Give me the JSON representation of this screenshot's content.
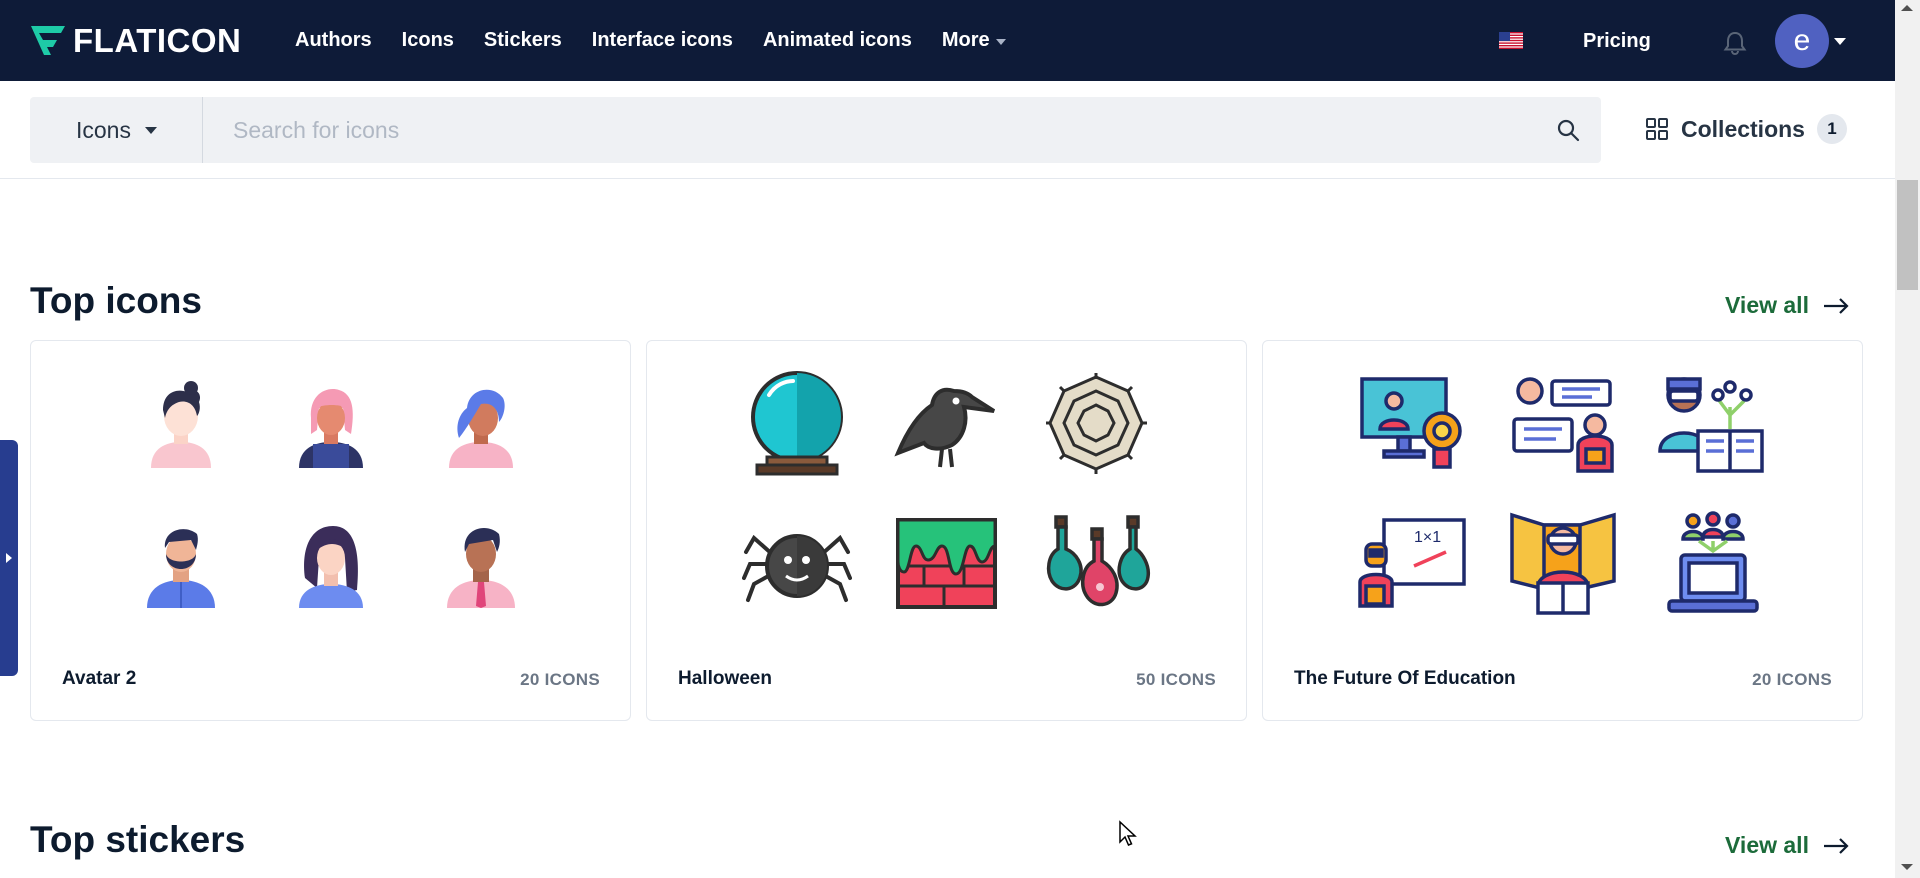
{
  "header": {
    "logo_text": "FLATICON",
    "nav": [
      {
        "label": "Authors"
      },
      {
        "label": "Icons"
      },
      {
        "label": "Stickers"
      },
      {
        "label": "Interface icons"
      },
      {
        "label": "Animated icons"
      },
      {
        "label": "More"
      }
    ],
    "pricing_label": "Pricing",
    "avatar_letter": "e"
  },
  "search": {
    "type_label": "Icons",
    "placeholder": "Search for icons",
    "collections_label": "Collections",
    "collections_count": "1"
  },
  "top_icons": {
    "title": "Top icons",
    "view_all": "View all",
    "packs": [
      {
        "name": "Avatar 2",
        "count": "20 ICONS",
        "icons": [
          "woman-bun-icon",
          "woman-pink-hair-icon",
          "woman-blue-hair-icon",
          "man-beard-icon",
          "woman-long-hair-icon",
          "man-tie-icon"
        ]
      },
      {
        "name": "Halloween",
        "count": "50 ICONS",
        "icons": [
          "crystal-ball-icon",
          "crow-icon",
          "spider-web-icon",
          "spider-icon",
          "slime-wall-icon",
          "potion-bottles-icon"
        ]
      },
      {
        "name": "The Future Of Education",
        "count": "20 ICONS",
        "icons": [
          "online-class-icon",
          "chat-students-icon",
          "vr-learning-icon",
          "robot-teacher-icon",
          "vr-reading-icon",
          "laptop-group-icon"
        ]
      }
    ]
  },
  "top_stickers": {
    "title": "Top stickers",
    "view_all": "View all"
  },
  "colors": {
    "header_bg": "#0e1b38",
    "accent_green": "#1c6b3a",
    "avatar_bg": "#5061c1",
    "logo_accent": "#1ecba7"
  }
}
